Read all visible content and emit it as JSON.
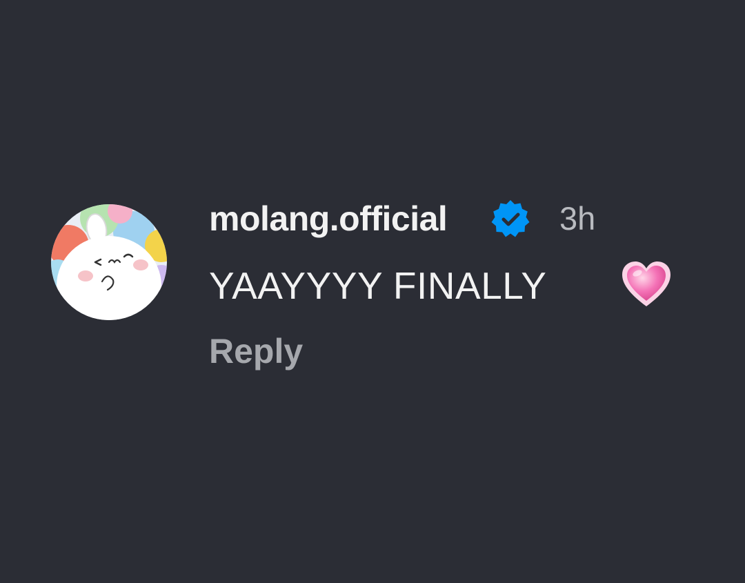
{
  "comment": {
    "username": "molang.official",
    "verified_icon": "verified-badge-icon",
    "timestamp": "3h",
    "text": "YAAYYYY FINALLY",
    "emoji_icon": "pink-heart-emoji-icon",
    "reply_label": "Reply",
    "avatar_icon": "molang-bunny-avatar"
  },
  "colors": {
    "background": "#2b2d35",
    "text": "#f2f2f2",
    "muted": "#a6a8ad",
    "verified_blue": "#0095f6",
    "heart_pink": "#f06ab0"
  }
}
